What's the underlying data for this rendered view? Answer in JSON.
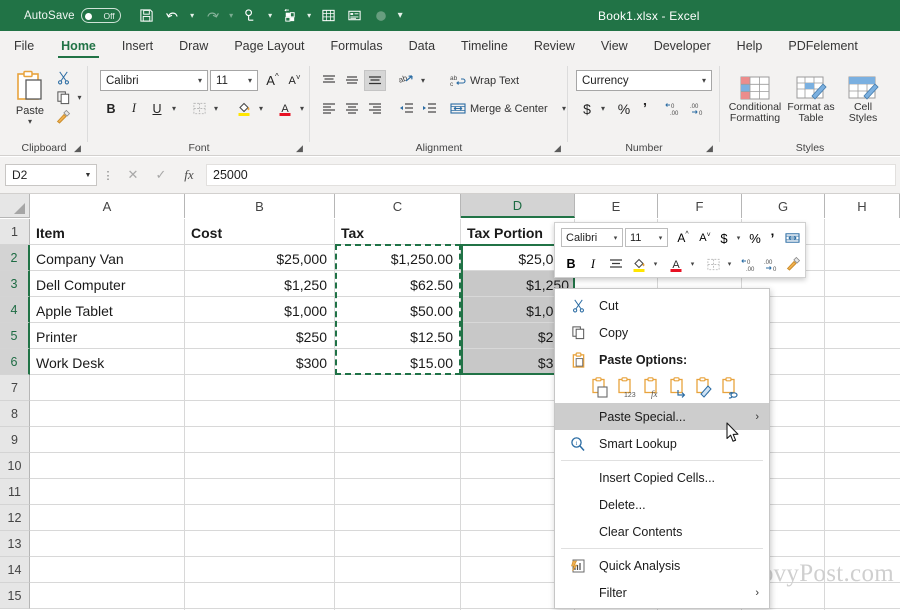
{
  "titlebar": {
    "autosave_label": "AutoSave",
    "autosave_state": "Off",
    "document_title": "Book1.xlsx  -  Excel",
    "quick_access": [
      {
        "name": "save-icon",
        "label": "Save"
      },
      {
        "name": "undo-icon",
        "label": "Undo"
      },
      {
        "name": "redo-icon",
        "label": "Redo"
      },
      {
        "name": "touch-mode-icon",
        "label": "Touch/Mouse Mode"
      },
      {
        "name": "new-icon",
        "label": "New"
      },
      {
        "name": "calculate-icon",
        "label": "Calculate Now"
      },
      {
        "name": "form-icon",
        "label": "Form"
      },
      {
        "name": "record-icon",
        "label": "Record Macro"
      },
      {
        "name": "customize-qat-icon",
        "label": "Customize Quick Access Toolbar"
      }
    ]
  },
  "tabs": [
    {
      "label": "File",
      "active": false
    },
    {
      "label": "Home",
      "active": true
    },
    {
      "label": "Insert",
      "active": false
    },
    {
      "label": "Draw",
      "active": false
    },
    {
      "label": "Page Layout",
      "active": false
    },
    {
      "label": "Formulas",
      "active": false
    },
    {
      "label": "Data",
      "active": false
    },
    {
      "label": "Timeline",
      "active": false
    },
    {
      "label": "Review",
      "active": false
    },
    {
      "label": "View",
      "active": false
    },
    {
      "label": "Developer",
      "active": false
    },
    {
      "label": "Help",
      "active": false
    },
    {
      "label": "PDFelement",
      "active": false
    }
  ],
  "ribbon": {
    "groups": [
      {
        "name": "clipboard",
        "label": "Clipboard"
      },
      {
        "name": "font",
        "label": "Font"
      },
      {
        "name": "alignment",
        "label": "Alignment"
      },
      {
        "name": "number",
        "label": "Number"
      },
      {
        "name": "styles",
        "label": "Styles"
      }
    ],
    "clipboard": {
      "paste_label": "Paste",
      "cut_label": "Cut",
      "copy_label": "Copy",
      "format_painter_label": "Format Painter"
    },
    "font": {
      "font_name": "Calibri",
      "font_size": "11",
      "grow_font_label": "A",
      "shrink_font_label": "A",
      "bold_label": "B",
      "italic_label": "I",
      "underline_label": "U"
    },
    "alignment": {
      "wrap_text_label": "Wrap Text",
      "merge_center_label": "Merge & Center"
    },
    "number": {
      "format_value": "Currency",
      "currency_label": "$",
      "percent_label": "%",
      "comma_label": "’"
    },
    "styles": {
      "conditional_formatting_label": "Conditional\nFormatting",
      "conditional_formatting_line1": "Conditional",
      "conditional_formatting_line2": "Formatting",
      "format_as_table_line1": "Format as",
      "format_as_table_line2": "Table",
      "cell_styles_line1": "Cell",
      "cell_styles_line2": "Styles"
    }
  },
  "formula_bar": {
    "name_box_value": "D2",
    "cancel_label": "✕",
    "enter_label": "✓",
    "function_label": "fx",
    "formula_value": "25000"
  },
  "grid": {
    "columns": [
      {
        "label": "A",
        "selected": false
      },
      {
        "label": "B",
        "selected": false
      },
      {
        "label": "C",
        "selected": false
      },
      {
        "label": "D",
        "selected": true
      },
      {
        "label": "E",
        "selected": false
      },
      {
        "label": "F",
        "selected": false
      },
      {
        "label": "G",
        "selected": false
      },
      {
        "label": "H",
        "selected": false
      }
    ],
    "rows": [
      "1",
      "2",
      "3",
      "4",
      "5",
      "6",
      "7",
      "8",
      "9",
      "10",
      "11",
      "12",
      "13",
      "14",
      "15"
    ],
    "selected_rows": [
      "2",
      "3",
      "4",
      "5",
      "6"
    ],
    "data": [
      {
        "row": "1",
        "A": "Item",
        "B": "Cost",
        "C": "Tax",
        "D": "Tax Portion",
        "bold": true
      },
      {
        "row": "2",
        "A": "Company Van",
        "B": "$25,000",
        "C": "$1,250.00",
        "D": "$25,000",
        "bold": false
      },
      {
        "row": "3",
        "A": "Dell Computer",
        "B": "$1,250",
        "C": "$62.50",
        "D": "$1,250",
        "bold": false
      },
      {
        "row": "4",
        "A": "Apple Tablet",
        "B": "$1,000",
        "C": "$50.00",
        "D": "$1,000",
        "bold": false
      },
      {
        "row": "5",
        "A": "Printer",
        "B": "$250",
        "C": "$12.50",
        "D": "$250",
        "bold": false
      },
      {
        "row": "6",
        "A": "Work Desk",
        "B": "$300",
        "C": "$15.00",
        "D": "$300",
        "bold": false
      }
    ],
    "copied_range": "C2:C6",
    "selected_range": "D2:D6",
    "active_cell": "D2"
  },
  "mini_toolbar": {
    "font_name": "Calibri",
    "font_size": "11",
    "grow_font_label": "A",
    "shrink_font_label": "A",
    "currency_label": "$",
    "percent_label": "%",
    "comma_label": "’",
    "bold_label": "B",
    "italic_label": "I"
  },
  "context_menu": {
    "items": [
      {
        "label": "Cut",
        "icon": "scissors-icon",
        "bold": false,
        "highlighted": false,
        "submenu": false
      },
      {
        "label": "Copy",
        "icon": "copy-icon",
        "bold": false,
        "highlighted": false,
        "submenu": false
      },
      {
        "label": "Paste Options:",
        "icon": "clipboard-icon",
        "bold": true,
        "highlighted": false,
        "submenu": false
      },
      {
        "label": "Paste Special...",
        "icon": "",
        "bold": false,
        "highlighted": true,
        "submenu": true
      },
      {
        "label": "Smart Lookup",
        "icon": "smart-lookup-icon",
        "bold": false,
        "highlighted": false,
        "submenu": false
      },
      {
        "label": "Insert Copied Cells...",
        "icon": "",
        "bold": false,
        "highlighted": false,
        "submenu": false
      },
      {
        "label": "Delete...",
        "icon": "",
        "bold": false,
        "highlighted": false,
        "submenu": false
      },
      {
        "label": "Clear Contents",
        "icon": "",
        "bold": false,
        "highlighted": false,
        "submenu": false
      },
      {
        "label": "Quick Analysis",
        "icon": "quick-analysis-icon",
        "bold": false,
        "highlighted": false,
        "submenu": false
      },
      {
        "label": "Filter",
        "icon": "",
        "bold": false,
        "highlighted": false,
        "submenu": true
      }
    ],
    "paste_options": [
      {
        "name": "paste-keep-source-formatting-icon",
        "label": ""
      },
      {
        "name": "paste-values-icon",
        "label": "123"
      },
      {
        "name": "paste-formulas-icon",
        "label": "fx"
      },
      {
        "name": "paste-transpose-icon",
        "label": ""
      },
      {
        "name": "paste-formatting-icon",
        "label": ""
      },
      {
        "name": "paste-link-icon",
        "label": ""
      }
    ]
  },
  "watermark": {
    "text": "groovyPost.com"
  },
  "colors": {
    "excel_green": "#217346",
    "ribbon_bg": "#f3f2f1",
    "menu_highlight": "#cdcdcd",
    "selection_shade": "#c8c8c8"
  }
}
